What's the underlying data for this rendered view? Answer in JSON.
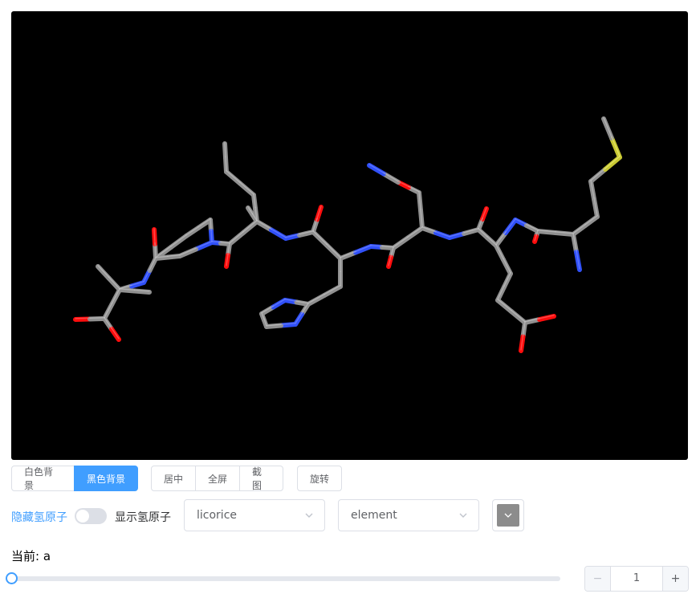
{
  "background_buttons": [
    {
      "label": "白色背景",
      "active": false
    },
    {
      "label": "黑色背景",
      "active": true
    }
  ],
  "view_buttons": [
    {
      "label": "居中"
    },
    {
      "label": "全屏"
    },
    {
      "label": "截图"
    }
  ],
  "rotate_button": {
    "label": "旋转"
  },
  "hydrogen_toggle": {
    "off_label": "隐藏氢原子",
    "on_label": "显示氢原子",
    "enabled": false
  },
  "representation_select": {
    "value": "licorice"
  },
  "color_scheme_select": {
    "value": "element"
  },
  "color_picker": {
    "value": "#8c8c8c"
  },
  "current": {
    "label": "当前: a"
  },
  "slider": {
    "value": 0
  },
  "model_stepper": {
    "value": "1",
    "decrement": "−",
    "increment": "+"
  },
  "colors": {
    "accent": "#409eff",
    "carbon": "#909090",
    "nitrogen": "#3050f8",
    "oxygen": "#ff0d0d",
    "sulfur": "#c8c832",
    "background": "#000000"
  }
}
